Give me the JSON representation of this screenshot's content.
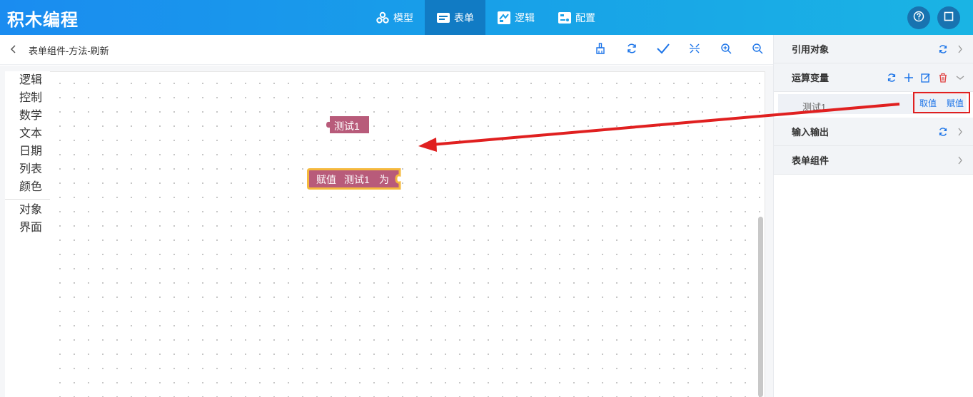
{
  "app": {
    "brand": "积木编程"
  },
  "nav": [
    {
      "label": "模型",
      "icon": "model-icon"
    },
    {
      "label": "表单",
      "icon": "form-icon",
      "active": true
    },
    {
      "label": "逻辑",
      "icon": "logic-icon"
    },
    {
      "label": "配置",
      "icon": "config-icon"
    }
  ],
  "subheader": {
    "title": "表单组件-方法-刷新"
  },
  "toolbox": {
    "categories": [
      "逻辑",
      "控制",
      "数学",
      "文本",
      "日期",
      "列表",
      "颜色"
    ],
    "extra": [
      "对象",
      "界面"
    ]
  },
  "blocks": {
    "get": {
      "text": "测试1"
    },
    "set": {
      "keyword": "赋值",
      "var": "测试1",
      "suffix": "为"
    }
  },
  "right_panel": {
    "sections": [
      {
        "title": "引用对象"
      },
      {
        "title": "运算变量"
      },
      {
        "title": "输入输出"
      },
      {
        "title": "表单组件"
      }
    ],
    "variable": {
      "name": "测试1",
      "get_label": "取值",
      "set_label": "赋值"
    }
  },
  "colors": {
    "topbar_start": "#1a8cf0",
    "topbar_end": "#1ab4e4",
    "nav_active": "#117bc4",
    "block_variable": "#b85b7a",
    "block_highlight": "#f5b93d",
    "link": "#1a73e8",
    "annotation_red": "#e02020",
    "delete_red": "#e04040"
  }
}
